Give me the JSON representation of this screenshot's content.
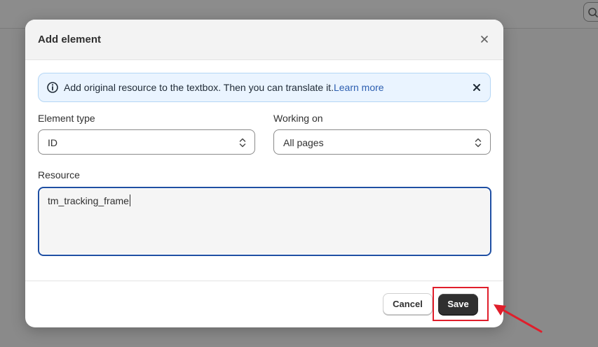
{
  "modal": {
    "title": "Add element"
  },
  "banner": {
    "text": "Add original resource to the textbox. Then you can translate it.",
    "link": "Learn more"
  },
  "form": {
    "element_type": {
      "label": "Element type",
      "value": "ID"
    },
    "working_on": {
      "label": "Working on",
      "value": "All pages"
    },
    "resource": {
      "label": "Resource",
      "value": "tm_tracking_frame"
    }
  },
  "footer": {
    "cancel_label": "Cancel",
    "save_label": "Save"
  },
  "colors": {
    "accent_dark": "#303030",
    "banner_bg": "#eaf4ff",
    "focus_border": "#1f4fa3",
    "annotation_red": "#e01e2b"
  },
  "icons": {
    "modal_close": "close-icon",
    "banner_info": "info-icon",
    "banner_close": "close-icon",
    "select_chevron": "chevron-up-down-icon",
    "background_search": "search-icon"
  }
}
